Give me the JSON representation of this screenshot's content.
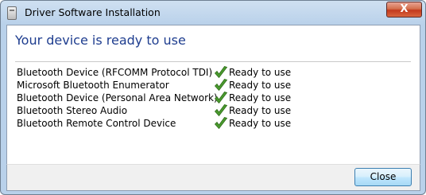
{
  "window": {
    "title": "Driver Software Installation",
    "close_glyph": "X"
  },
  "main": {
    "heading": "Your device is ready to use",
    "devices": [
      {
        "name": "Bluetooth Device (RFCOMM Protocol TDI)",
        "status": "Ready to use",
        "icon": "check-icon"
      },
      {
        "name": "Microsoft Bluetooth Enumerator",
        "status": "Ready to use",
        "icon": "check-icon"
      },
      {
        "name": "Bluetooth Device (Personal Area Network)",
        "status": "Ready to use",
        "icon": "check-icon"
      },
      {
        "name": "Bluetooth Stereo Audio",
        "status": "Ready to use",
        "icon": "check-icon"
      },
      {
        "name": "Bluetooth Remote Control Device",
        "status": "Ready to use",
        "icon": "check-icon"
      }
    ]
  },
  "footer": {
    "close_label": "Close"
  },
  "colors": {
    "heading": "#1e3d8f",
    "check": "#4a9a2e"
  }
}
